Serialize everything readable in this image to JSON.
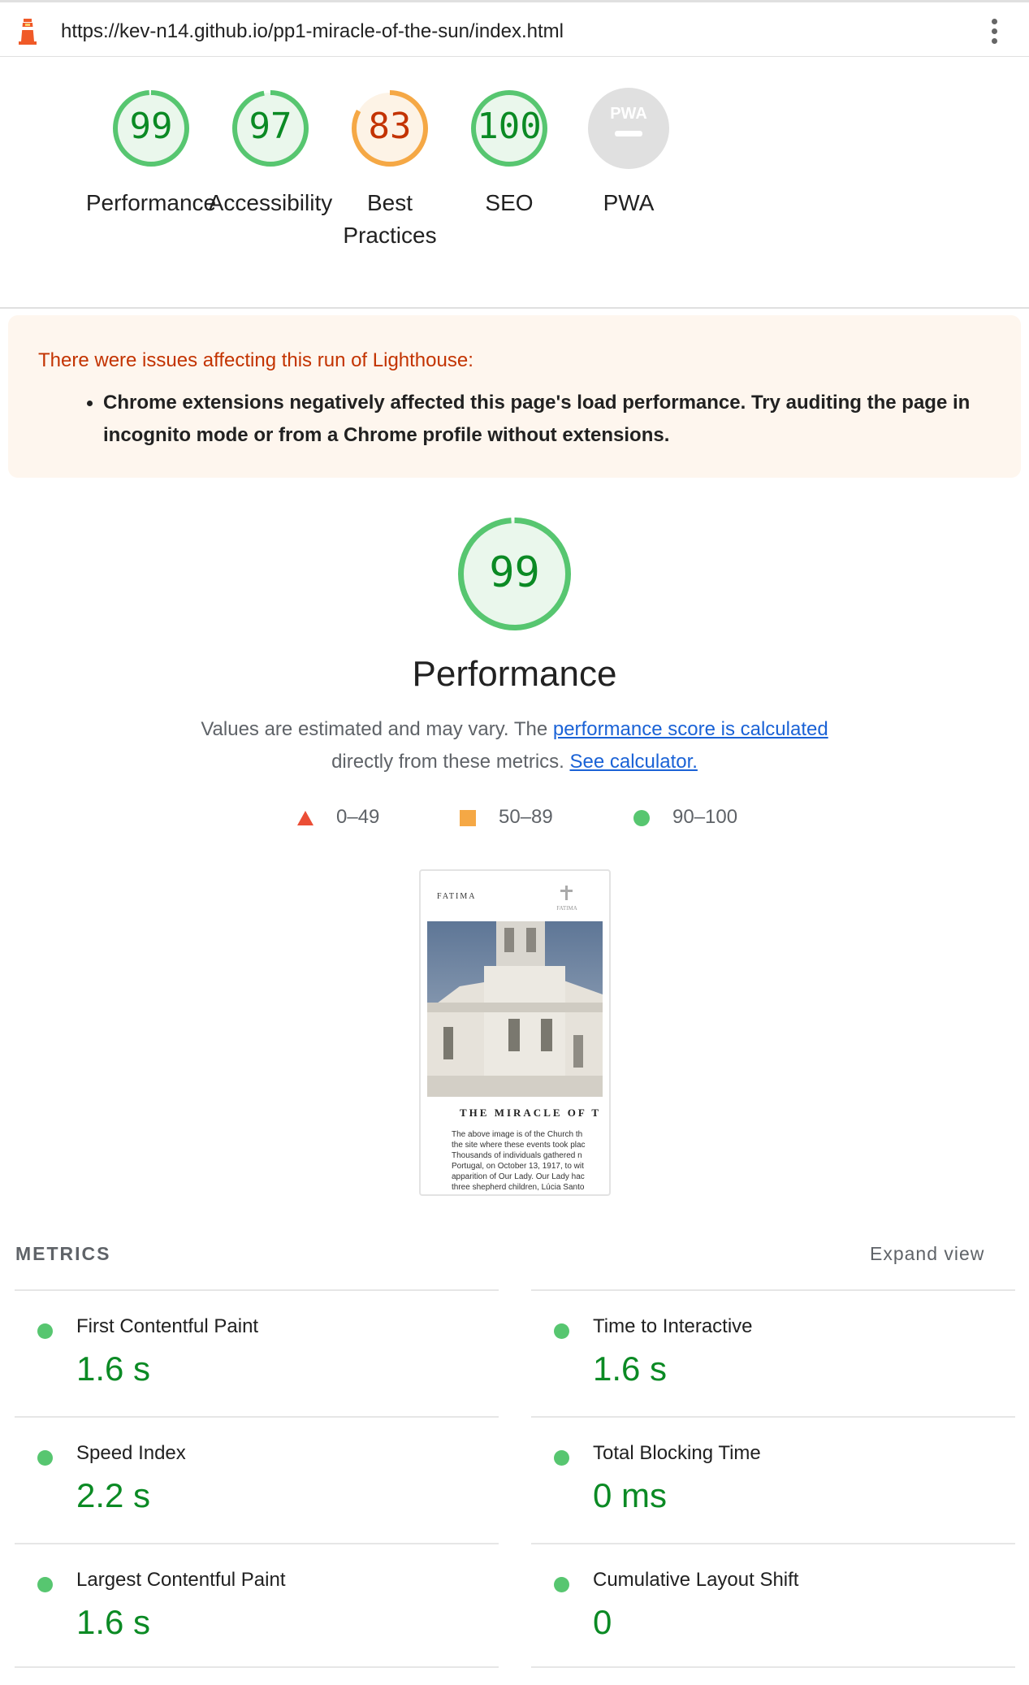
{
  "url_bar": {
    "url": "https://kev-n14.github.io/pp1-miracle-of-the-sun/index.html"
  },
  "categories": [
    {
      "label": "Performance",
      "score": "99",
      "score_value": 99,
      "rating": "pass"
    },
    {
      "label": "Accessibility",
      "score": "97",
      "score_value": 97,
      "rating": "pass"
    },
    {
      "label": "Best Practices",
      "label_line1": "Best",
      "label_line2": "Practices",
      "score": "83",
      "score_value": 83,
      "rating": "average"
    },
    {
      "label": "SEO",
      "score": "100",
      "score_value": 100,
      "rating": "pass"
    },
    {
      "label": "PWA",
      "badge": "PWA"
    }
  ],
  "warning": {
    "title": "There were issues affecting this run of Lighthouse:",
    "items": [
      "Chrome extensions negatively affected this page's load performance. Try auditing the page in incognito mode or from a Chrome profile without extensions."
    ]
  },
  "performance": {
    "score": "99",
    "score_value": 99,
    "title": "Performance",
    "desc_part1": "Values are estimated and may vary. The ",
    "desc_link1": "performance score is calculated",
    "desc_part2": "directly from these metrics.",
    "desc_link2": "See calculator."
  },
  "legend": {
    "fail": "0–49",
    "average": "50–89",
    "pass": "90–100"
  },
  "thumbnail": {
    "brand": "FATIMA",
    "logo_text": "FATIMA",
    "headline": "THE MIRACLE OF T",
    "body_lines": [
      "The above image is of the Church th",
      "the site where these events took plac",
      "Thousands of individuals gathered n",
      "Portugal, on October 13, 1917, to wit",
      "apparition of Our Lady. Our Lady hac",
      "three shepherd children, Lúcia Santo"
    ]
  },
  "metrics": {
    "heading": "METRICS",
    "expand_label": "Expand view",
    "items": [
      {
        "name": "First Contentful Paint",
        "value": "1.6 s"
      },
      {
        "name": "Time to Interactive",
        "value": "1.6 s"
      },
      {
        "name": "Speed Index",
        "value": "2.2 s"
      },
      {
        "name": "Total Blocking Time",
        "value": "0 ms"
      },
      {
        "name": "Largest Contentful Paint",
        "value": "1.6 s"
      },
      {
        "name": "Cumulative Layout Shift",
        "value": "0"
      }
    ]
  },
  "colors": {
    "pass": "#0b8a24",
    "pass_ring": "#57c670",
    "pass_fill": "#eaf7ec",
    "average": "#c33300",
    "average_ring": "#f5a845",
    "average_fill": "#fdf3e6",
    "fail": "#eb4e36",
    "link": "#1a62d6",
    "warning_bg": "#fef6ee"
  }
}
